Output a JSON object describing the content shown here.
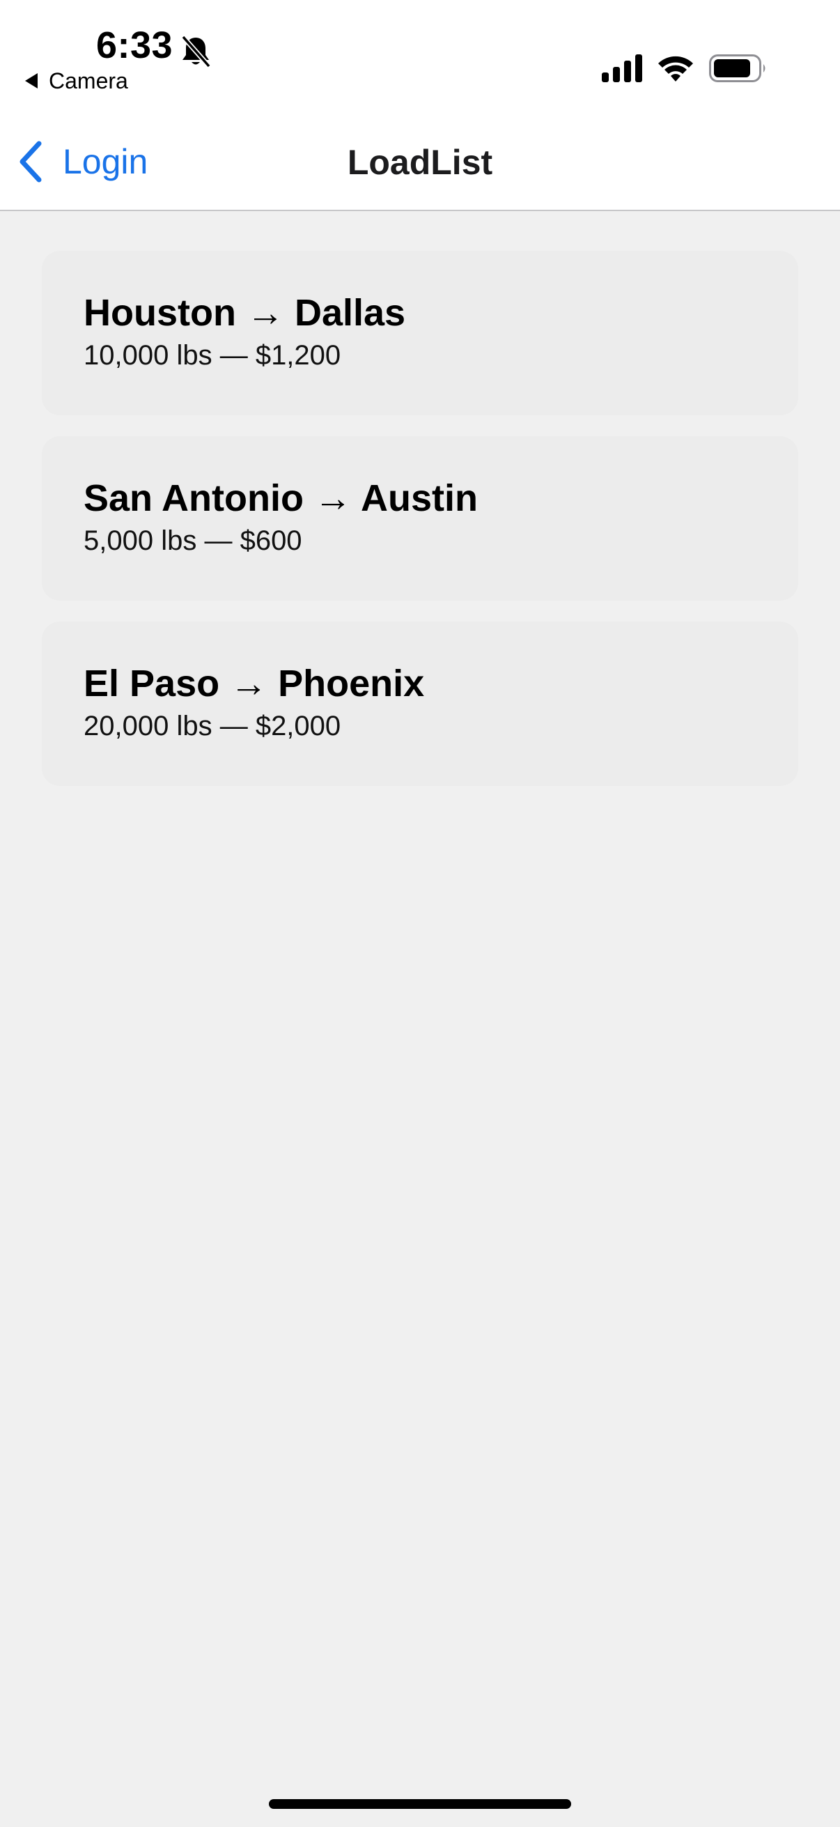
{
  "status_bar": {
    "time": "6:33",
    "back_app_label": "Camera",
    "icons": [
      "bell-slash-icon",
      "cellular-signal-icon",
      "wifi-icon",
      "battery-icon"
    ]
  },
  "nav": {
    "back_label": "Login",
    "title": "LoadList"
  },
  "loads": [
    {
      "route": "Houston → Dallas",
      "details": "10,000 lbs — $1,200"
    },
    {
      "route": "San Antonio → Austin",
      "details": "5,000 lbs — $600"
    },
    {
      "route": "El Paso → Phoenix",
      "details": "20,000 lbs — $2,000"
    }
  ],
  "colors": {
    "accent": "#1A73E8",
    "background": "#F0F0F0",
    "card": "#ECECEC",
    "bar": "#FFFFFF"
  }
}
